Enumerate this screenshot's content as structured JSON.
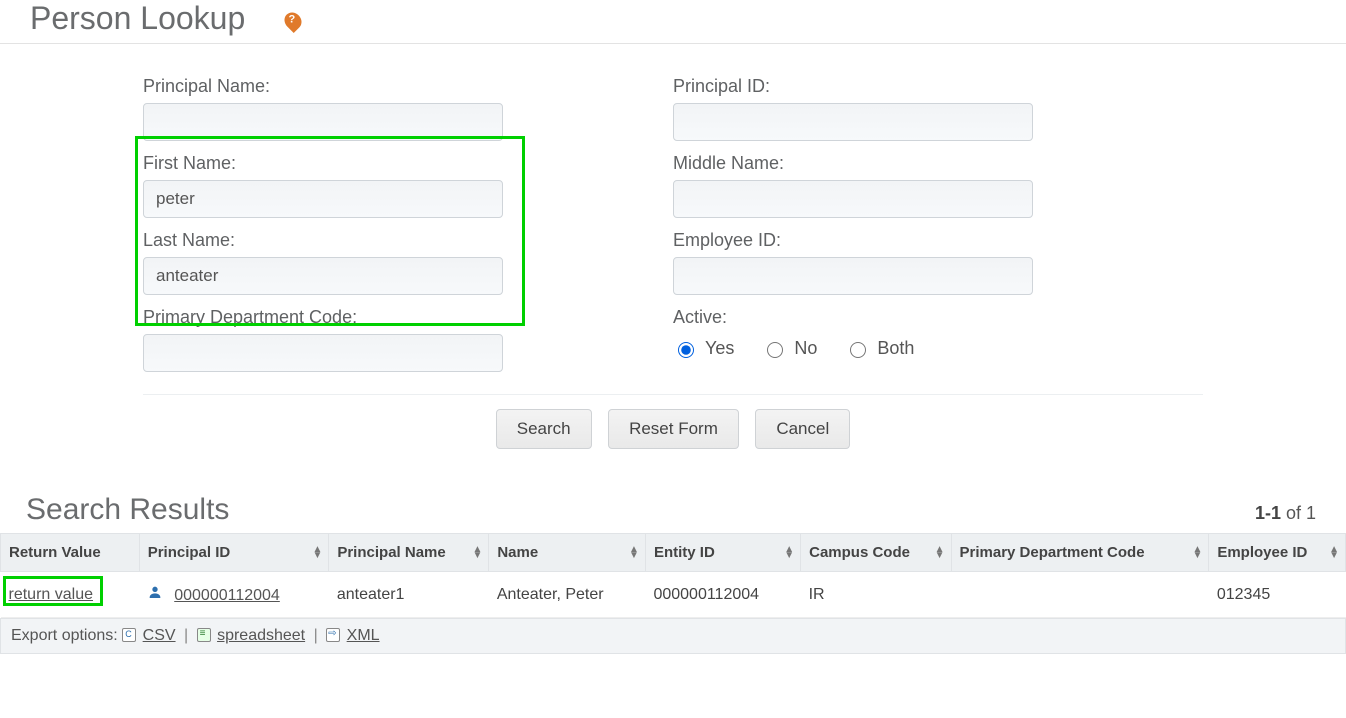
{
  "page": {
    "title": "Person Lookup"
  },
  "form": {
    "principal_name": {
      "label": "Principal Name:",
      "value": ""
    },
    "principal_id": {
      "label": "Principal ID:",
      "value": ""
    },
    "first_name": {
      "label": "First Name:",
      "value": "peter"
    },
    "middle_name": {
      "label": "Middle Name:",
      "value": ""
    },
    "last_name": {
      "label": "Last Name:",
      "value": "anteater"
    },
    "employee_id": {
      "label": "Employee ID:",
      "value": ""
    },
    "primary_dept": {
      "label": "Primary Department Code:",
      "value": ""
    },
    "active": {
      "label": "Active:",
      "yes": "Yes",
      "no": "No",
      "both": "Both",
      "selected": "yes"
    }
  },
  "buttons": {
    "search": "Search",
    "reset": "Reset Form",
    "cancel": "Cancel"
  },
  "results": {
    "title": "Search Results",
    "count_bold": "1-1",
    "count_rest": " of 1",
    "columns": {
      "return_value": "Return Value",
      "principal_id": "Principal ID",
      "principal_name": "Principal Name",
      "name": "Name",
      "entity_id": "Entity ID",
      "campus_code": "Campus Code",
      "primary_dept": "Primary Department Code",
      "employee_id": "Employee ID"
    },
    "rows": [
      {
        "return_value": "return value",
        "principal_id": "000000112004",
        "principal_name": "anteater1",
        "name": "Anteater, Peter",
        "entity_id": "000000112004",
        "campus_code": "IR",
        "primary_dept": "",
        "employee_id": "012345"
      }
    ]
  },
  "export": {
    "label": "Export options:",
    "csv": "CSV",
    "spreadsheet": "spreadsheet",
    "xml": "XML"
  }
}
